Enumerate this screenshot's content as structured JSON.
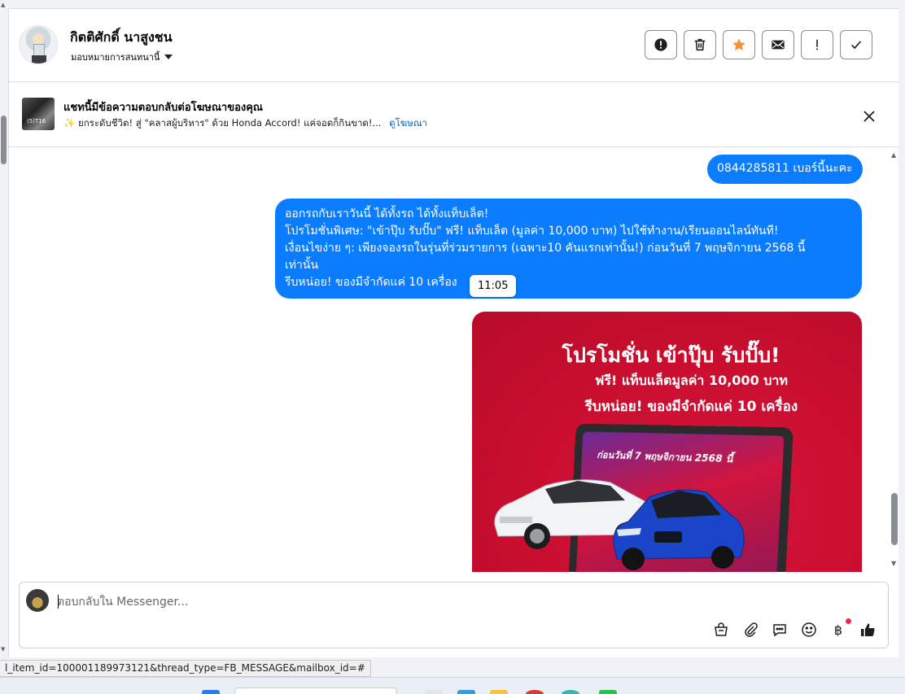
{
  "header": {
    "contact_name": "กิตติศักดิ์ นาสูงชน",
    "assign_label": "มอบหมายการสนทนานี้",
    "actions": [
      {
        "name": "spam-button",
        "icon": "exclamation-circle-icon"
      },
      {
        "name": "delete-button",
        "icon": "trash-icon"
      },
      {
        "name": "star-button",
        "icon": "star-icon"
      },
      {
        "name": "mark-unread-button",
        "icon": "envelope-icon"
      },
      {
        "name": "follow-up-button",
        "icon": "exclamation-icon"
      },
      {
        "name": "mark-done-button",
        "icon": "check-icon"
      }
    ],
    "star_color": "#f7923b"
  },
  "ad_notice": {
    "title": "แชทนี้มีข้อความตอบกลับต่อโฆษณาของคุณ",
    "subtitle": "✨ ยกระดับชีวิต! สู่ \"คลาสผู้บริหาร\" ด้วย Honda Accord! แค่จอดก็กินขาด!...",
    "link": "ดูโฆษณา",
    "thumb_text": "(5)T16"
  },
  "messages": {
    "msg1": "0844285811 เบอร์นี้นะคะ",
    "msg2_lines": [
      "ออกรถกับเราวันนี้ ได้ทั้งรถ ได้ทั้งแท็บเล็ต!",
      "โปรโมชั่นพิเศษ: \"เข้าปุ๊บ รับปั๊บ\" ฟรี! แท็บเล็ต (มูลค่า 10,000 บาท) ไปใช้ทำงาน/เรียนออนไลน์ทันที!",
      "เงื่อนไขง่าย ๆ: เพียงจองรถในรุ่นที่ร่วมรายการ (เฉพาะ10 คันแรกเท่านั้น!) ก่อนวันที่ 7 พฤษจิกายน 2568 นี้",
      "เท่านั้น",
      "รีบหน่อย! ของมีจำกัดแค่ 10 เครื่อง"
    ],
    "timestamp": "11:05",
    "bubble_color": "#0a7cff"
  },
  "promo_image": {
    "headline": "โปรโมชั่น เข้าปุ๊บ รับปั๊บ!",
    "line2": "ฟรี! แท็บแล็ตมูลค่า 10,000 บาท",
    "line3": "รีบหน่อย! ของมีจำกัดแค่ 10 เครื่อง",
    "screen_date": "ก่อนวันที่ 7 พฤษจิกายน 2568 นี้",
    "bg_color": "#c90e2f"
  },
  "composer": {
    "placeholder": "ตอบกลับใน Messenger...",
    "tools": [
      "shopping-bag-icon",
      "paperclip-icon",
      "chat-bubble-icon",
      "smiley-icon",
      "baht-icon",
      "thumbs-up-icon"
    ]
  },
  "status_url": "l_item_id=100001189973121&thread_type=FB_MESSAGE&mailbox_id=#"
}
